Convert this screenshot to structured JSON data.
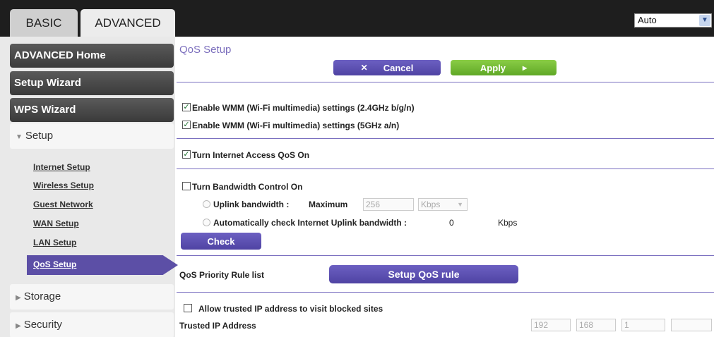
{
  "topbar": {
    "tabs": {
      "basic": "BASIC",
      "advanced": "ADVANCED"
    },
    "language": "Auto"
  },
  "sidebar": {
    "advanced_home": "ADVANCED Home",
    "setup_wizard": "Setup Wizard",
    "wps_wizard": "WPS Wizard",
    "setup": "Setup",
    "setup_links": [
      "Internet Setup",
      "Wireless Setup",
      "Guest Network",
      "WAN Setup",
      "LAN Setup"
    ],
    "qos_setup": "QoS Setup",
    "storage": "Storage",
    "security": "Security"
  },
  "main": {
    "title": "QoS Setup",
    "cancel_label": "Cancel",
    "apply_label": "Apply",
    "wmm_24": "Enable WMM (Wi-Fi multimedia) settings (2.4GHz b/g/n)",
    "wmm_5": "Enable WMM (Wi-Fi multimedia) settings (5GHz a/n)",
    "internet_qos": "Turn Internet Access QoS On",
    "bandwidth_control": "Turn Bandwidth Control On",
    "uplink_bandwidth": "Uplink bandwidth :",
    "maximum": "Maximum",
    "uplink_value": "256",
    "uplink_unit": "Kbps",
    "auto_check": "Automatically check Internet Uplink bandwidth :",
    "auto_value": "0",
    "auto_unit": "Kbps",
    "check_label": "Check",
    "priority_rule_list": "QoS Priority Rule list",
    "setup_qos_rule": "Setup QoS rule",
    "allow_trusted": "Allow trusted IP address to visit blocked sites",
    "trusted_ip": "Trusted IP Address",
    "ip_octets": [
      "192",
      "168",
      "1",
      ""
    ]
  }
}
